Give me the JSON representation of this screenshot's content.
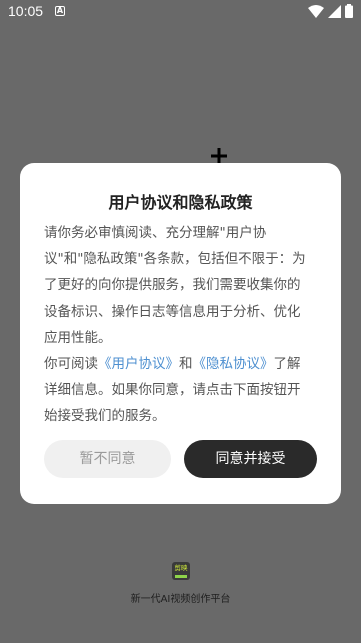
{
  "status_bar": {
    "time": "10:05",
    "notification_icon": "A"
  },
  "dialog": {
    "title": "用户协议和隐私政策",
    "paragraph1": {
      "line1": "请你务必审慎阅读、充分理解\"用户协",
      "line2": "议\"和\"隐私政策\"各条款，包括但不限于：为",
      "line3": "了更好的向你提供服务，我们需要收集你的",
      "line4": "设备标识、操作日志等信息用于分析、优化",
      "line5": "应用性能。"
    },
    "paragraph2": {
      "prefix": "你可阅读",
      "user_agreement_link": "《用户协议》",
      "and": "和",
      "privacy_link": "《隐私协议》",
      "suffix": "了解",
      "line2": "详细信息。如果你同意，请点击下面按钮开",
      "line3": "始接受我们的服务。"
    },
    "disagree_label": "暂不同意",
    "agree_label": "同意并接受"
  },
  "app": {
    "logo_text": "剪映",
    "tagline": "新一代AI视频创作平台"
  },
  "colors": {
    "background": "#696969",
    "link": "#4d8fd0",
    "agree_button": "#2a2a2a"
  }
}
